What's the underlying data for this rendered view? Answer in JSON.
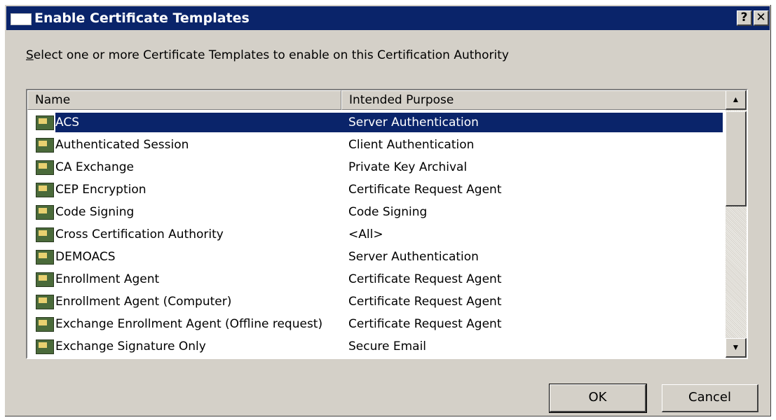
{
  "window": {
    "title": "Enable Certificate Templates",
    "help_glyph": "?",
    "close_glyph": "✕"
  },
  "instruction": {
    "accel": "S",
    "rest": "elect one or more Certificate Templates to enable on this Certification Authority"
  },
  "list": {
    "columns": [
      "Name",
      "Intended Purpose"
    ],
    "rows": [
      {
        "name": "ACS",
        "purpose": "Server Authentication",
        "selected": true
      },
      {
        "name": "Authenticated Session",
        "purpose": "Client Authentication"
      },
      {
        "name": "CA Exchange",
        "purpose": "Private Key Archival"
      },
      {
        "name": "CEP Encryption",
        "purpose": "Certificate Request Agent"
      },
      {
        "name": "Code Signing",
        "purpose": "Code Signing"
      },
      {
        "name": "Cross Certification Authority",
        "purpose": "<All>"
      },
      {
        "name": "DEMOACS",
        "purpose": "Server Authentication"
      },
      {
        "name": "Enrollment Agent",
        "purpose": "Certificate Request Agent"
      },
      {
        "name": "Enrollment Agent (Computer)",
        "purpose": "Certificate Request Agent"
      },
      {
        "name": "Exchange Enrollment Agent (Offline request)",
        "purpose": "Certificate Request Agent"
      },
      {
        "name": "Exchange Signature Only",
        "purpose": "Secure Email"
      }
    ]
  },
  "buttons": {
    "ok": "OK",
    "cancel": "Cancel"
  },
  "icons": {
    "row_icon": "certificate-template-icon",
    "scroll_up": "scroll-up-arrow-icon",
    "scroll_down": "scroll-down-arrow-icon"
  },
  "colors": {
    "titlebar": "#0a246a",
    "selection": "#0a246a",
    "face": "#d4d0c8"
  }
}
